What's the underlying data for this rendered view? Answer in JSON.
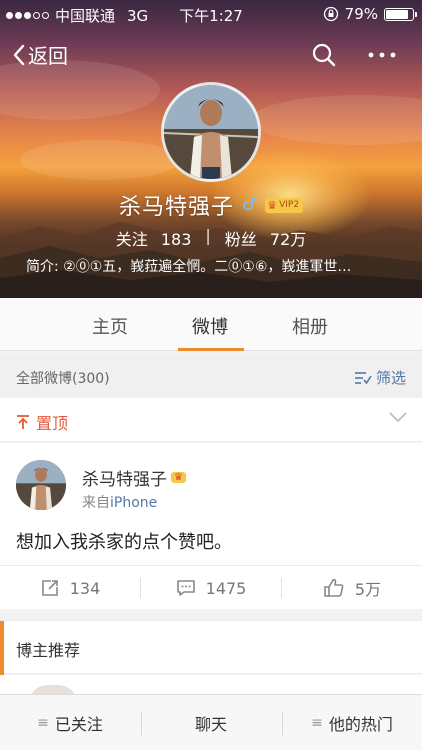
{
  "status_bar": {
    "carrier": "中国联通",
    "network": "3G",
    "time": "下午1:27",
    "battery": "79%",
    "battery_level": 0.79
  },
  "nav": {
    "back_label": "返回"
  },
  "profile": {
    "name": "杀马特强子",
    "vip_label": "VIP2",
    "following_label": "关注",
    "following_count": "183",
    "followers_label": "粉丝",
    "followers_count": "72万",
    "stats_separator": "|",
    "bio": "简介: ②⓪①五，峩菈遍全惘。二⓪①⑥，峩進軍世…"
  },
  "tabs": [
    {
      "label": "主页",
      "active": false
    },
    {
      "label": "微博",
      "active": true
    },
    {
      "label": "相册",
      "active": false
    }
  ],
  "filter": {
    "all_label": "全部微博(300)",
    "filter_label": "筛选"
  },
  "pinned": {
    "label": "置顶"
  },
  "post": {
    "author": "杀马特强子",
    "source_prefix": "来自",
    "source_device": "iPhone",
    "content": "想加入我杀家的点个赞吧。",
    "reposts": "134",
    "comments": "1475",
    "likes": "5万"
  },
  "recommend": {
    "title": "博主推荐"
  },
  "bottom_bar": {
    "followed": "已关注",
    "chat": "聊天",
    "hot": "他的热门"
  },
  "colors": {
    "accent": "#f08b2a",
    "link": "#5378a8",
    "pin": "#e8593a"
  }
}
